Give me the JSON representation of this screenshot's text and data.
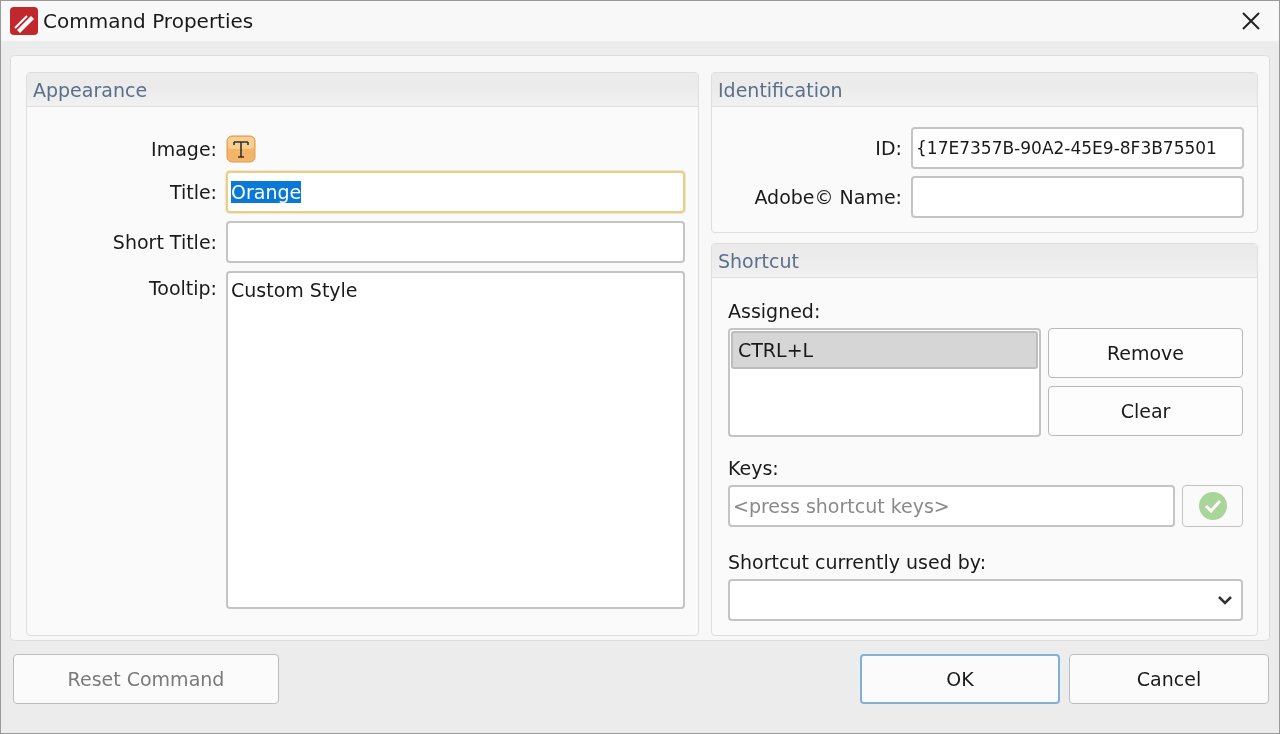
{
  "window": {
    "title": "Command Properties"
  },
  "appearance": {
    "heading": "Appearance",
    "image_label": "Image:",
    "title_label": "Title:",
    "title_value": "Orange",
    "title_value_selected": true,
    "short_title_label": "Short Title:",
    "tooltip_label": "Tooltip:",
    "tooltip_value": "Custom Style"
  },
  "identification": {
    "heading": "Identification",
    "id_label": "ID:",
    "id_value": "{17E7357B-90A2-45E9-8F3B75501",
    "adobe_name_label": "Adobe© Name:"
  },
  "shortcut": {
    "heading": "Shortcut",
    "assigned_label": "Assigned:",
    "assigned": [
      {
        "label": "CTRL+L",
        "selected": true
      }
    ],
    "remove": "Remove",
    "clear": "Clear",
    "keys_label": "Keys:",
    "keys_placeholder": "<press shortcut keys>",
    "used_by_label": "Shortcut currently used by:"
  },
  "buttons": [
    {
      "label": "Reset Command",
      "disabled": true,
      "default": false
    },
    {
      "label": "OK",
      "disabled": false,
      "default": true
    },
    {
      "label": "Cancel",
      "disabled": false,
      "default": false
    }
  ]
}
